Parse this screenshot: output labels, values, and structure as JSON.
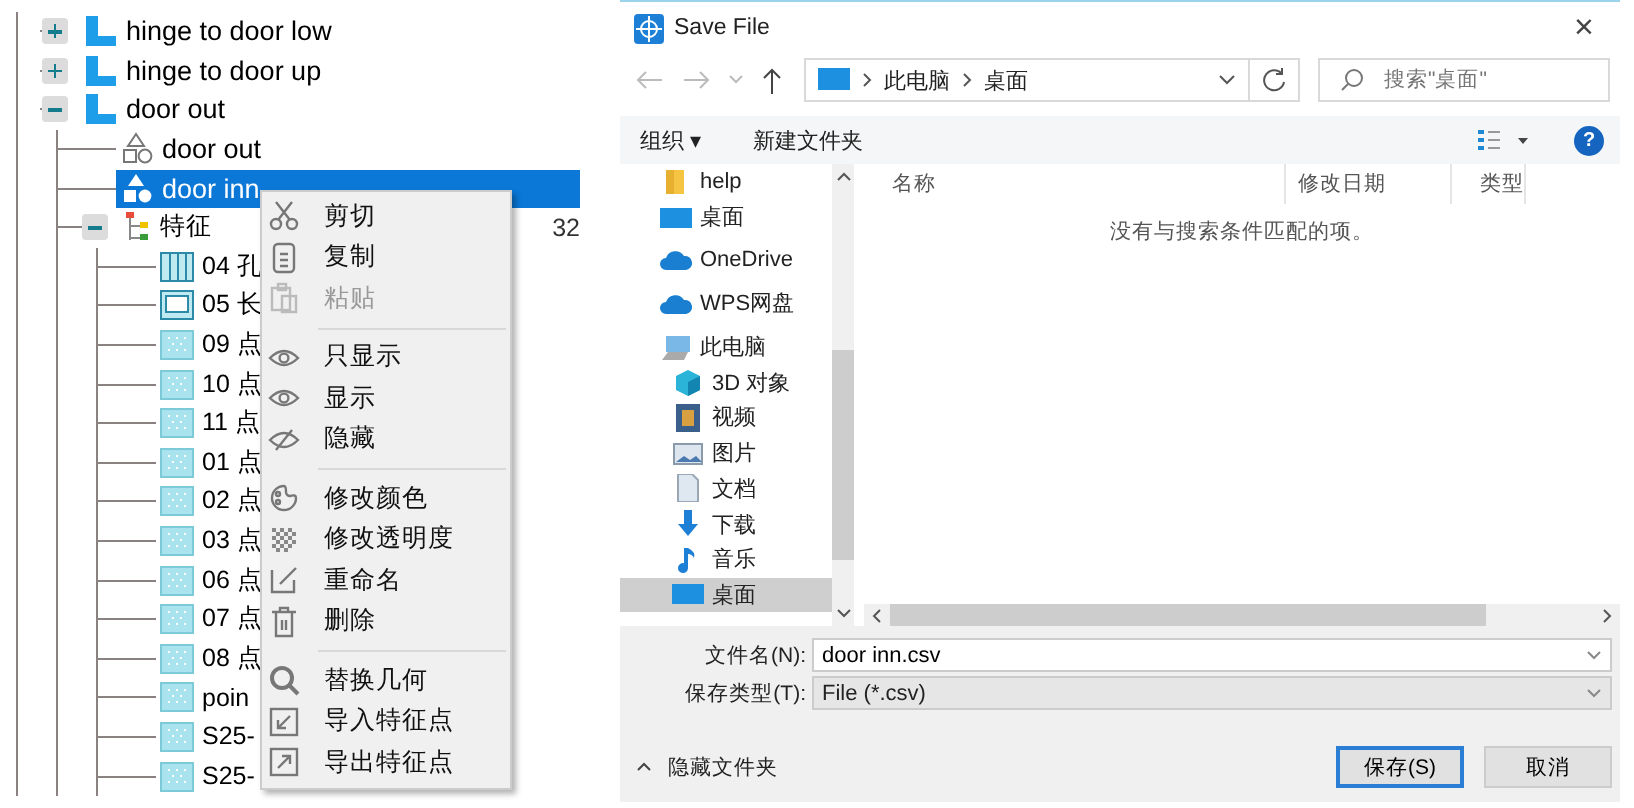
{
  "tree": [
    {
      "label": "hinge to door low",
      "kind": "part",
      "expanded": false,
      "selected": false
    },
    {
      "label": "hinge to door up",
      "kind": "part",
      "expanded": false,
      "selected": false
    },
    {
      "label": "door out",
      "kind": "part",
      "expanded": true,
      "selected": false,
      "children": [
        {
          "label": "door out",
          "kind": "assembly",
          "selected": false
        },
        {
          "label": "door inn",
          "kind": "assembly",
          "selected": true
        },
        {
          "label": "特征",
          "kind": "features",
          "expanded": true,
          "selected": false,
          "value": "32",
          "children": [
            {
              "label": "04 孔",
              "kind": "hole",
              "selected": false
            },
            {
              "label": "05 长",
              "kind": "slot",
              "selected": false
            },
            {
              "label": "09 点",
              "kind": "points",
              "selected": false
            },
            {
              "label": "10 点",
              "kind": "points",
              "selected": false
            },
            {
              "label": "11 点",
              "kind": "points",
              "selected": false
            },
            {
              "label": "01 点",
              "kind": "points",
              "selected": false
            },
            {
              "label": "02 点",
              "kind": "points",
              "selected": false
            },
            {
              "label": "03 点",
              "kind": "points",
              "selected": false
            },
            {
              "label": "06 点",
              "kind": "points",
              "selected": false
            },
            {
              "label": "07 点",
              "kind": "points",
              "selected": false
            },
            {
              "label": "08 点",
              "kind": "points",
              "selected": false
            },
            {
              "label": "poin",
              "kind": "points",
              "selected": false
            },
            {
              "label": "S25-",
              "kind": "points",
              "selected": false
            },
            {
              "label": "S25-",
              "kind": "points",
              "selected": false
            }
          ]
        }
      ]
    }
  ],
  "context_menu": {
    "groups": [
      {
        "items": [
          {
            "label": "剪切",
            "disabled": false
          },
          {
            "label": "复制",
            "disabled": false
          },
          {
            "label": "粘贴",
            "disabled": true
          }
        ]
      },
      {
        "items": [
          {
            "label": "只显示",
            "disabled": false
          },
          {
            "label": "显示",
            "disabled": false
          },
          {
            "label": "隐藏",
            "disabled": false
          }
        ]
      },
      {
        "items": [
          {
            "label": "修改颜色",
            "disabled": false
          },
          {
            "label": "修改透明度",
            "disabled": false
          },
          {
            "label": "重命名",
            "disabled": false
          },
          {
            "label": "删除",
            "disabled": false
          }
        ]
      },
      {
        "items": [
          {
            "label": "替换几何",
            "disabled": false
          },
          {
            "label": "导入特征点",
            "disabled": false
          },
          {
            "label": "导出特征点",
            "disabled": false
          }
        ]
      }
    ]
  },
  "dialog": {
    "title": "Save File",
    "close": "×",
    "breadcrumb": [
      "此电脑",
      "桌面"
    ],
    "search": {
      "placeholder": "搜索\"桌面\""
    },
    "toolbar": {
      "organize": "组织 ▾",
      "new_folder": "新建文件夹",
      "help": "?"
    },
    "nav": [
      {
        "label": "help",
        "kind": "folder",
        "selected": false
      },
      {
        "label": "桌面",
        "kind": "desktop",
        "selected": false
      },
      {
        "label": "OneDrive",
        "kind": "cloud",
        "selected": false
      },
      {
        "label": "WPS网盘",
        "kind": "cloud",
        "selected": false
      },
      {
        "label": "此电脑",
        "kind": "pc",
        "selected": false,
        "children": [
          {
            "label": "3D 对象",
            "kind": "cube",
            "selected": false
          },
          {
            "label": "视频",
            "kind": "video",
            "selected": false
          },
          {
            "label": "图片",
            "kind": "picture",
            "selected": false
          },
          {
            "label": "文档",
            "kind": "document",
            "selected": false
          },
          {
            "label": "下载",
            "kind": "download",
            "selected": false
          },
          {
            "label": "音乐",
            "kind": "music",
            "selected": false
          },
          {
            "label": "桌面",
            "kind": "desktop",
            "selected": true
          }
        ]
      }
    ],
    "columns": [
      "名称",
      "修改日期",
      "类型"
    ],
    "empty_message": "没有与搜索条件匹配的项。",
    "filename": {
      "label": "文件名(N):",
      "value": "door inn.csv"
    },
    "filetype": {
      "label": "保存类型(T):",
      "value": "File (*.csv)"
    },
    "hide_folders": "隐藏文件夹",
    "buttons": [
      {
        "label": "保存(S)",
        "kind": "primary"
      },
      {
        "label": "取消",
        "kind": "normal"
      }
    ]
  }
}
